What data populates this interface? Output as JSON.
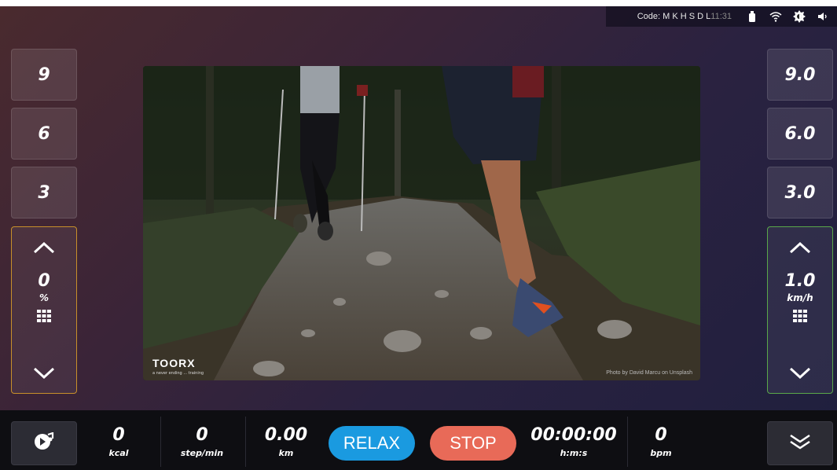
{
  "status": {
    "code_label": "Code:",
    "code_value": "M K H S D L",
    "ghost_time": "11:31",
    "icons": [
      "usb-icon",
      "wifi-icon",
      "brightness-icon",
      "volume-icon"
    ]
  },
  "incline_presets": [
    "9",
    "6",
    "3"
  ],
  "speed_presets": [
    "9.0",
    "6.0",
    "3.0"
  ],
  "incline": {
    "value": "0",
    "unit": "%"
  },
  "speed": {
    "value": "1.0",
    "unit": "km/h"
  },
  "video": {
    "brand": "TOORX",
    "tagline": "a never ending ... training",
    "credit": "Photo by David Marcu on Unsplash"
  },
  "metrics": {
    "kcal": {
      "value": "0",
      "unit": "kcal"
    },
    "steps": {
      "value": "0",
      "unit": "step/min"
    },
    "distance": {
      "value": "0.00",
      "unit": "km"
    },
    "time": {
      "value": "00:00:00",
      "unit": "h:m:s"
    },
    "heart": {
      "value": "0",
      "unit": "bpm"
    }
  },
  "buttons": {
    "relax": "RELAX",
    "stop": "STOP"
  },
  "colors": {
    "incline_border": "#c8902a",
    "speed_border": "#5aa84a",
    "relax": "#1a9ae0",
    "stop": "#e86a58"
  }
}
